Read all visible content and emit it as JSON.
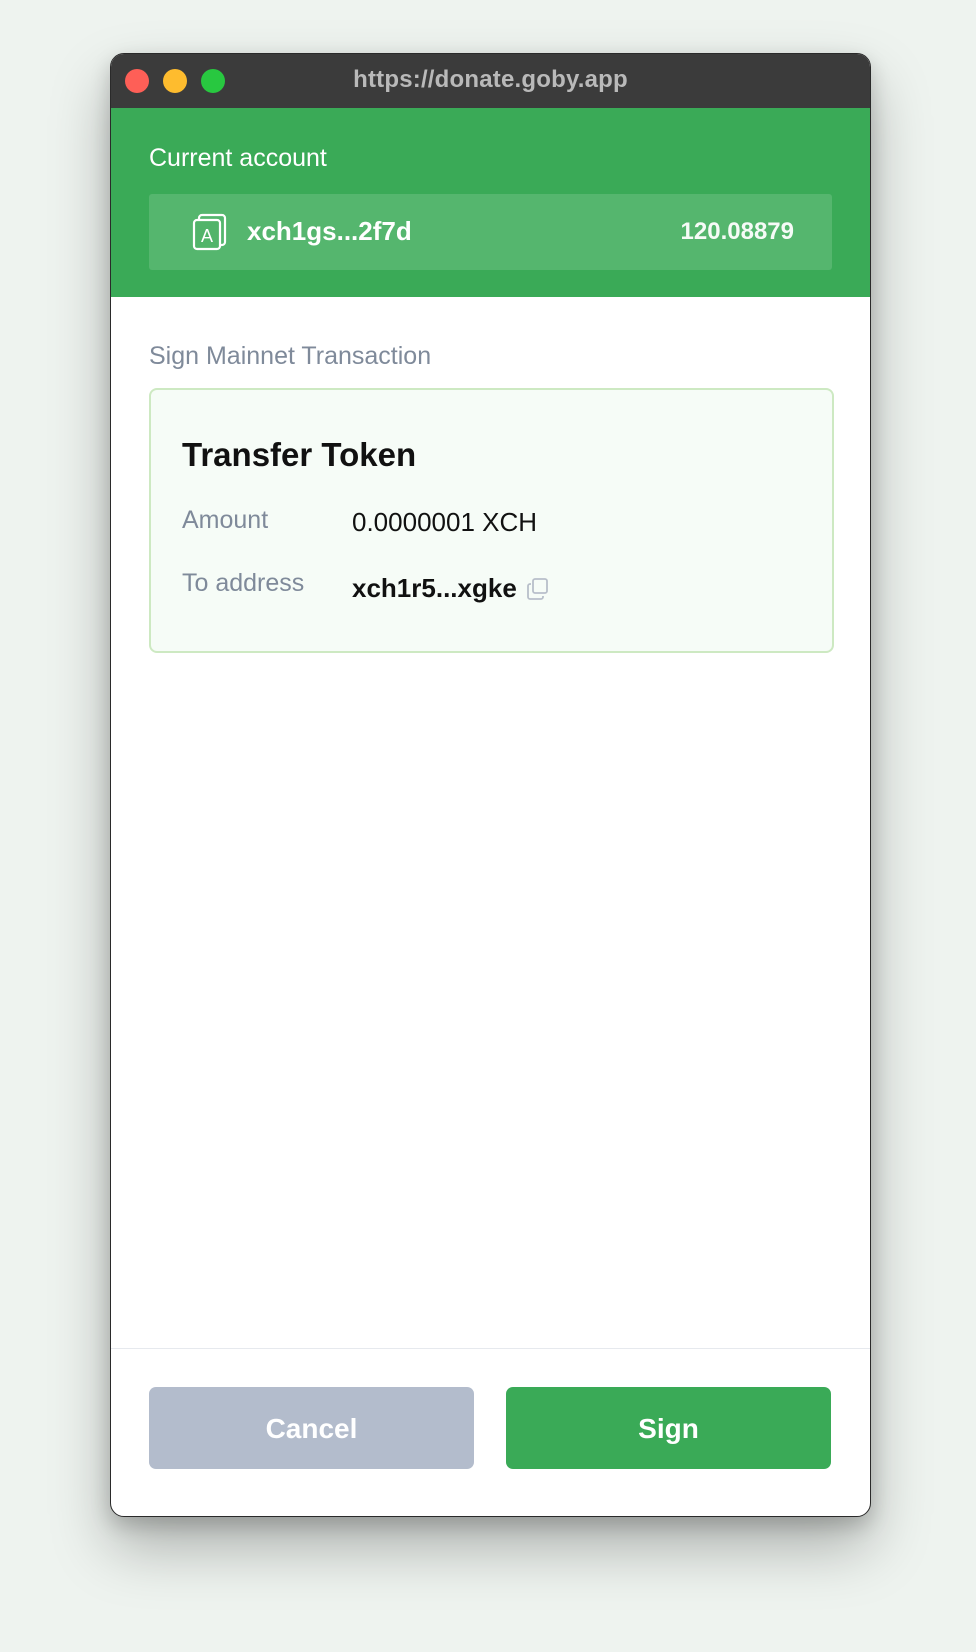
{
  "window": {
    "url": "https://donate.goby.app"
  },
  "account": {
    "label": "Current account",
    "icon": "account-avatar-icon",
    "icon_letter": "A",
    "address": "xch1gs...2f7d",
    "balance": "120.08879"
  },
  "transaction": {
    "section_title": "Sign Mainnet Transaction",
    "title": "Transfer Token",
    "amount_label": "Amount",
    "amount_value": "0.0000001 XCH",
    "to_label": "To address",
    "to_value": "xch1r5...xgke",
    "copy_icon": "copy-icon"
  },
  "actions": {
    "cancel_label": "Cancel",
    "sign_label": "Sign"
  },
  "colors": {
    "brand_green": "#3aaa57",
    "cancel_gray": "#b3bccc",
    "titlebar": "#3b3b3b"
  }
}
